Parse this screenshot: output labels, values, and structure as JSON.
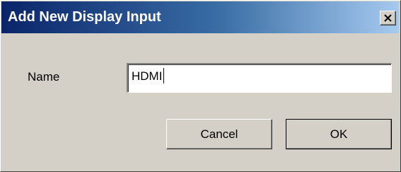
{
  "dialog": {
    "title": "Add New Display Input",
    "close_icon": "close-icon"
  },
  "form": {
    "name_label": "Name",
    "name_value": "HDMI"
  },
  "buttons": {
    "cancel_label": "Cancel",
    "ok_label": "OK"
  },
  "colors": {
    "titlebar_start": "#0a246a",
    "titlebar_end": "#a6caf0",
    "face": "#d4d0c8"
  }
}
